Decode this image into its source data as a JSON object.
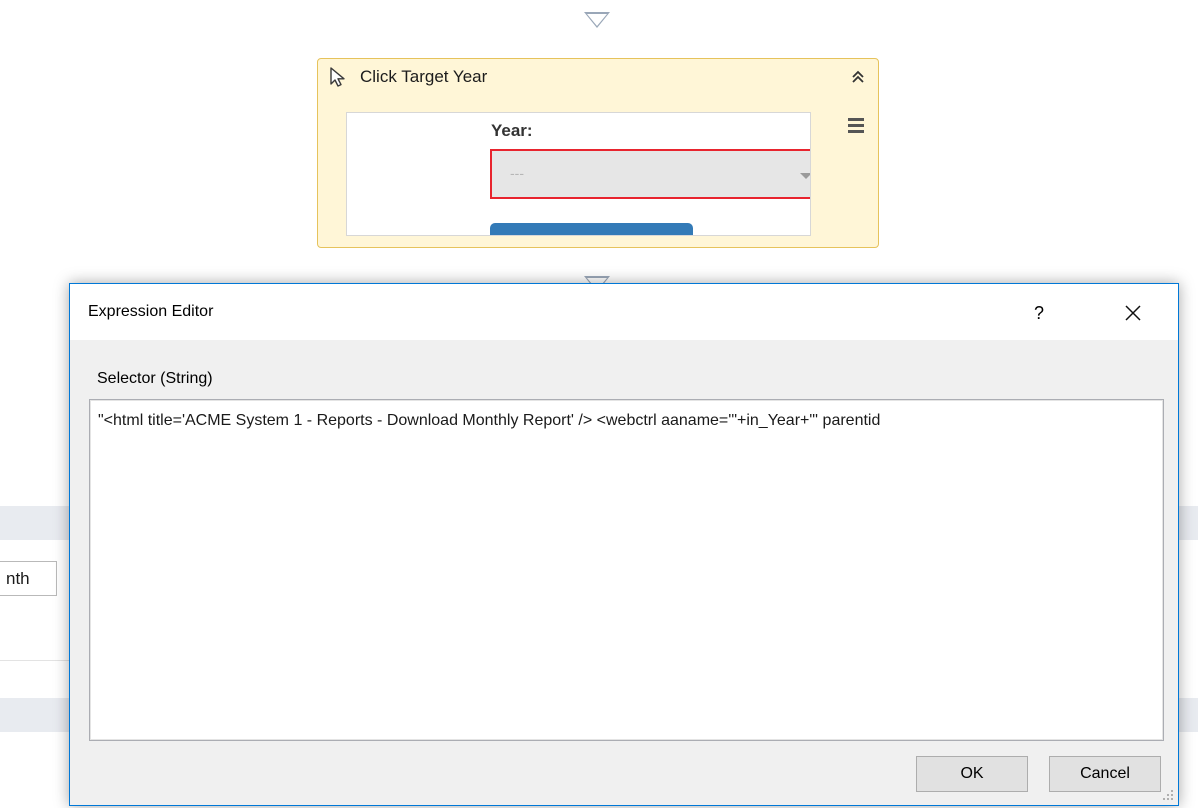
{
  "canvas": {
    "activity": {
      "title": "Click Target Year",
      "icon": "cursor-pointer-icon",
      "collapse_icon": "double-chevron-up-icon",
      "menu_icon": "hamburger-menu-icon",
      "preview": {
        "field_label": "Year:",
        "select_value": "---"
      }
    },
    "background_panel": {
      "partial_input_value": "nth"
    }
  },
  "dialog": {
    "title": "Expression Editor",
    "help_label": "?",
    "close_icon": "close-icon",
    "field_label": "Selector (String)",
    "expression": "\"<html title='ACME System 1 - Reports - Download Monthly Report' /> <webctrl aaname='\"+in_Year+\"' parentid",
    "buttons": {
      "ok": "OK",
      "cancel": "Cancel"
    }
  },
  "colors": {
    "activity_header_bg": "#fff6d7",
    "activity_border": "#e6c35c",
    "selector_highlight": "#e8242e",
    "preview_button": "#337ab7",
    "dialog_accent": "#0078d7"
  }
}
